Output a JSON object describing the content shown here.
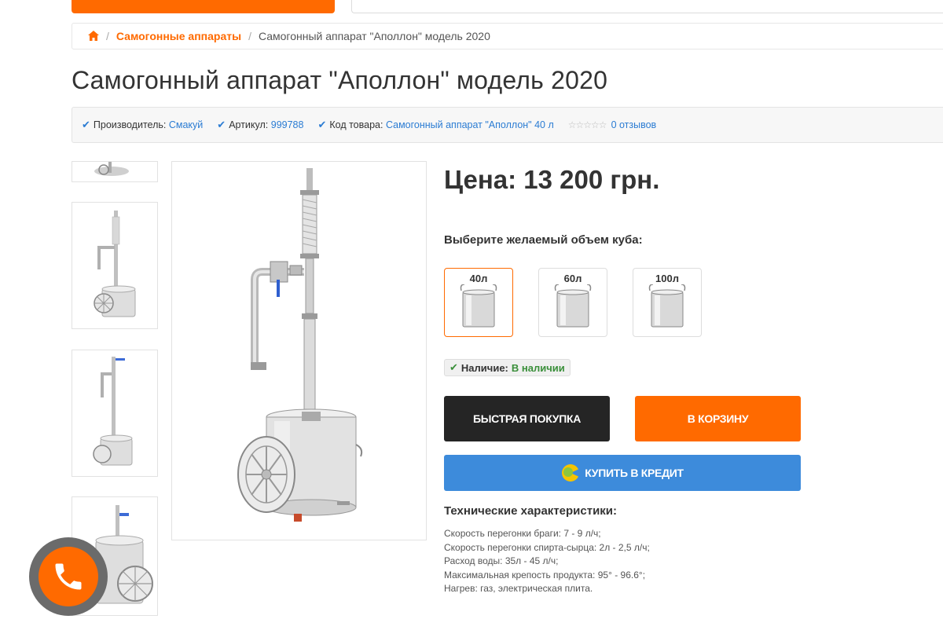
{
  "breadcrumb": {
    "category": "Самогонные аппараты",
    "current": "Самогонный аппарат \"Аполлон\" модель 2020"
  },
  "product": {
    "title": "Самогонный аппарат \"Аполлон\" модель 2020",
    "manufacturer_label": "Производитель:",
    "manufacturer": "Смакуй",
    "article_label": "Артикул:",
    "article": "999788",
    "code_label": "Код товара:",
    "code": "Самогонный аппарат \"Аполлон\" 40 л",
    "rating_stars": 0,
    "reviews": "0 отзывов",
    "price": "Цена: 13 200 грн."
  },
  "volume": {
    "label": "Выберите желаемый объем куба:",
    "options": [
      {
        "name": "40л",
        "selected": true
      },
      {
        "name": "60л",
        "selected": false
      },
      {
        "name": "100л",
        "selected": false
      }
    ]
  },
  "stock": {
    "label": "Наличие:",
    "value": "В наличии"
  },
  "buttons": {
    "quick_buy": "БЫСТРАЯ ПОКУПКА",
    "add_to_cart": "В КОРЗИНУ",
    "credit": "КУПИТЬ В КРЕДИТ"
  },
  "specs": {
    "title": "Технические характеристики:",
    "items": [
      "Скорость перегонки браги: 7 - 9 л/ч;",
      "Скорость перегонки спирта-сырца: 2л - 2,5 л/ч;",
      "Расход воды: 35л - 45 л/ч;",
      "Максимальная крепость продукта: 95° - 96.6°;",
      "Нагрев: газ, электрическая плита."
    ]
  },
  "colors": {
    "accent": "#ff6a00",
    "link": "#2b7cd3",
    "dark_button": "#252525",
    "credit_button": "#3d8bdb",
    "in_stock": "#3a8f3a"
  }
}
